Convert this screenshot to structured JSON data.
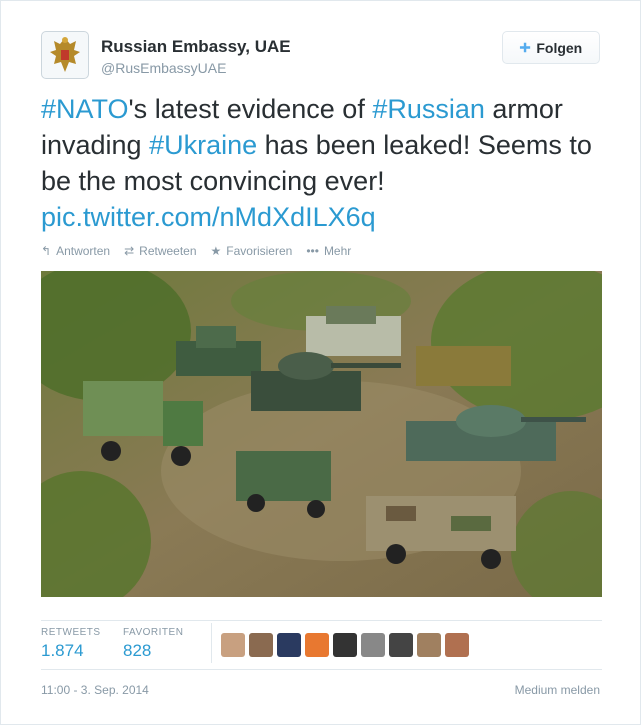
{
  "user": {
    "name": "Russian Embassy, UAE",
    "handle": "@RusEmbassyUAE",
    "avatar_icon": "coat-of-arms-icon"
  },
  "follow_button": {
    "label": "Folgen",
    "icon": "add-user-icon"
  },
  "tweet": {
    "parts": [
      {
        "text": "#NATO",
        "type": "hashtag"
      },
      {
        "text": "'s latest evidence of ",
        "type": "text"
      },
      {
        "text": "#Russian",
        "type": "hashtag"
      },
      {
        "text": " armor invading ",
        "type": "text"
      },
      {
        "text": "#Ukraine",
        "type": "hashtag"
      },
      {
        "text": " has been leaked! Seems to be the most convincing ever! ",
        "type": "text"
      },
      {
        "text": "pic.twitter.com/nMdXdILX6q",
        "type": "link"
      }
    ]
  },
  "actions": {
    "reply": "Antworten",
    "retweet": "Retweeten",
    "favorite": "Favorisieren",
    "more": "Mehr"
  },
  "stats": {
    "retweets_label": "RETWEETS",
    "retweets_value": "1.874",
    "favorites_label": "FAVORITEN",
    "favorites_value": "828"
  },
  "faces": [
    "#c8a080",
    "#8a6a50",
    "#2a3a60",
    "#e87830",
    "#333333",
    "#888888",
    "#444444",
    "#a08060",
    "#b07050"
  ],
  "footer": {
    "timestamp": "11:00 - 3. Sep. 2014",
    "report": "Medium melden"
  },
  "colors": {
    "link": "#2b9ad1",
    "muted": "#8899a6",
    "text": "#292f33"
  }
}
